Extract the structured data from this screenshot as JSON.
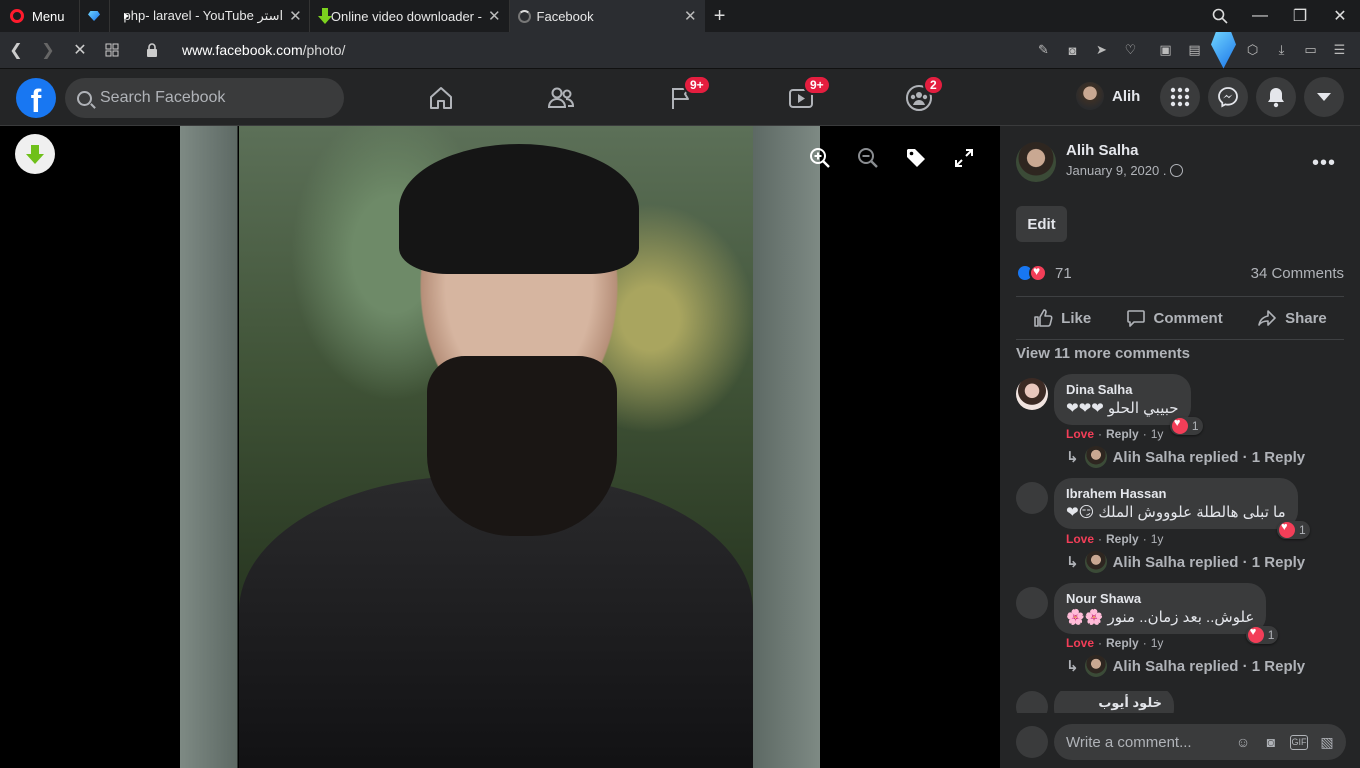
{
  "browser": {
    "menu_label": "Menu",
    "tabs": [
      {
        "title": "php- laravel - YouTube استر"
      },
      {
        "title": "Online video downloader -"
      },
      {
        "title": "Facebook"
      }
    ],
    "url_host": "www.facebook.com",
    "url_path": "/photo/"
  },
  "fbnav": {
    "search_placeholder": "Search Facebook",
    "badges": {
      "pages": "9+",
      "watch": "9+",
      "groups": "2"
    },
    "user_name": "Alih"
  },
  "post": {
    "author": "Alih Salha",
    "date": "January 9, 2020 .",
    "edit_label": "Edit",
    "reaction_count": "71",
    "comments_count": "34 Comments",
    "actions": {
      "like": "Like",
      "comment": "Comment",
      "share": "Share"
    },
    "view_more": "View 11 more comments"
  },
  "comments": [
    {
      "name": "Dina Salha",
      "text": "حبيبي الحلو ❤❤❤",
      "react_count": "1",
      "love": "Love",
      "reply": "Reply",
      "age": "1y",
      "replied": "Alih Salha replied · 1 Reply"
    },
    {
      "name": "Ibrahem Hassan",
      "text": "ما تبلى هالطلة علوووش الملك 😏❤",
      "react_count": "1",
      "love": "Love",
      "reply": "Reply",
      "age": "1y",
      "replied": "Alih Salha replied · 1 Reply"
    },
    {
      "name": "Nour Shawa",
      "text": "علوش.. بعد زمان.. منور 🌸🌸",
      "react_count": "1",
      "love": "Love",
      "reply": "Reply",
      "age": "1y",
      "replied": "Alih Salha replied · 1 Reply"
    },
    {
      "name": "خلود أيوب"
    }
  ],
  "write_placeholder": "Write a comment...",
  "colors": {
    "fb_blue": "#1877f2",
    "badge_red": "#e41e3f",
    "love_red": "#f33e58",
    "panel_bg": "#242526"
  }
}
